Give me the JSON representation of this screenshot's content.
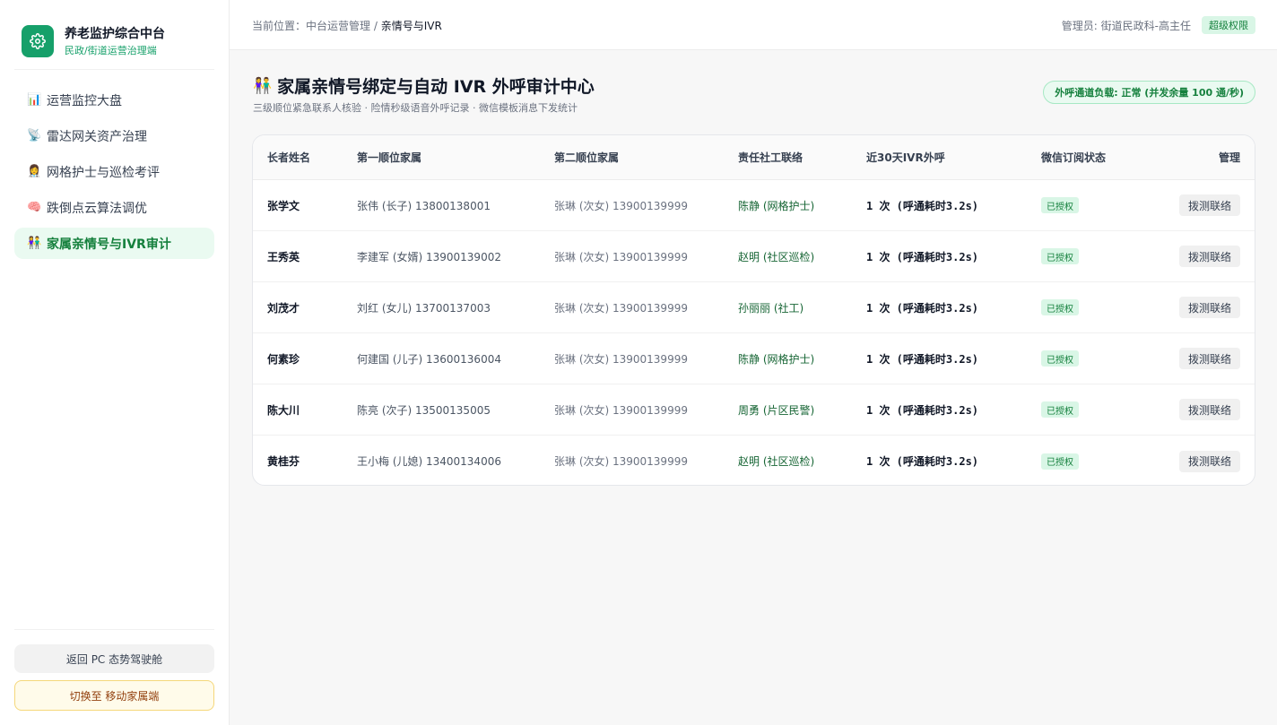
{
  "brand": {
    "title": "养老监护综合中台",
    "subtitle": "民政/街道运营治理端",
    "icon": "gear-icon",
    "accent": "#16a06a"
  },
  "sidebar": {
    "items": [
      {
        "icon": "bar-chart-icon",
        "glyph": "📊",
        "label": "运营监控大盘",
        "active": false
      },
      {
        "icon": "satellite-icon",
        "glyph": "📡",
        "label": "雷达网关资产治理",
        "active": false
      },
      {
        "icon": "nurse-icon",
        "glyph": "👩‍⚕️",
        "label": "网格护士与巡检考评",
        "active": false
      },
      {
        "icon": "brain-icon",
        "glyph": "🧠",
        "label": "跌倒点云算法调优",
        "active": false
      },
      {
        "icon": "family-icon",
        "glyph": "👫",
        "label": "家属亲情号与IVR审计",
        "active": true
      }
    ],
    "back_button": "返回 PC 态势驾驶舱",
    "switch_button": "切换至 移动家属端"
  },
  "header": {
    "breadcrumb_prefix": "当前位置：",
    "breadcrumb_parent": "中台运营管理",
    "breadcrumb_sep": " / ",
    "breadcrumb_current": "亲情号与IVR",
    "admin": "管理员: 街道民政科-高主任",
    "badge": "超级权限"
  },
  "main": {
    "title_emoji": "👫",
    "title": "家属亲情号绑定与自动 IVR 外呼审计中心",
    "subtitle": "三级顺位紧急联系人核验 · 险情秒级语音外呼记录 · 微信模板消息下发统计",
    "load_status": "外呼通道负载: 正常 (并发余量 100 通/秒)"
  },
  "table": {
    "columns": [
      "长者姓名",
      "第一顺位家属",
      "第二顺位家属",
      "责任社工联络",
      "近30天IVR外呼",
      "微信订阅状态",
      "管理"
    ],
    "rows": [
      {
        "name": "张学文",
        "first": "张伟 (长子) 13800138001",
        "second": "张琳 (次女) 13900139999",
        "social": "陈静 (网格护士)",
        "ivr": "1 次 (呼通耗时3.2s)",
        "wx": "已授权",
        "action": "拨测联络"
      },
      {
        "name": "王秀英",
        "first": "李建军 (女婿) 13900139002",
        "second": "张琳 (次女) 13900139999",
        "social": "赵明 (社区巡检)",
        "ivr": "1 次 (呼通耗时3.2s)",
        "wx": "已授权",
        "action": "拨测联络"
      },
      {
        "name": "刘茂才",
        "first": "刘红 (女儿) 13700137003",
        "second": "张琳 (次女) 13900139999",
        "social": "孙丽丽 (社工)",
        "ivr": "1 次 (呼通耗时3.2s)",
        "wx": "已授权",
        "action": "拨测联络"
      },
      {
        "name": "何素珍",
        "first": "何建国 (儿子) 13600136004",
        "second": "张琳 (次女) 13900139999",
        "social": "陈静 (网格护士)",
        "ivr": "1 次 (呼通耗时3.2s)",
        "wx": "已授权",
        "action": "拨测联络"
      },
      {
        "name": "陈大川",
        "first": "陈亮 (次子) 13500135005",
        "second": "张琳 (次女) 13900139999",
        "social": "周勇 (片区民警)",
        "ivr": "1 次 (呼通耗时3.2s)",
        "wx": "已授权",
        "action": "拨测联络"
      },
      {
        "name": "黄桂芬",
        "first": "王小梅 (儿媳) 13400134006",
        "second": "张琳 (次女) 13900139999",
        "social": "赵明 (社区巡检)",
        "ivr": "1 次 (呼通耗时3.2s)",
        "wx": "已授权",
        "action": "拨测联络"
      }
    ]
  }
}
